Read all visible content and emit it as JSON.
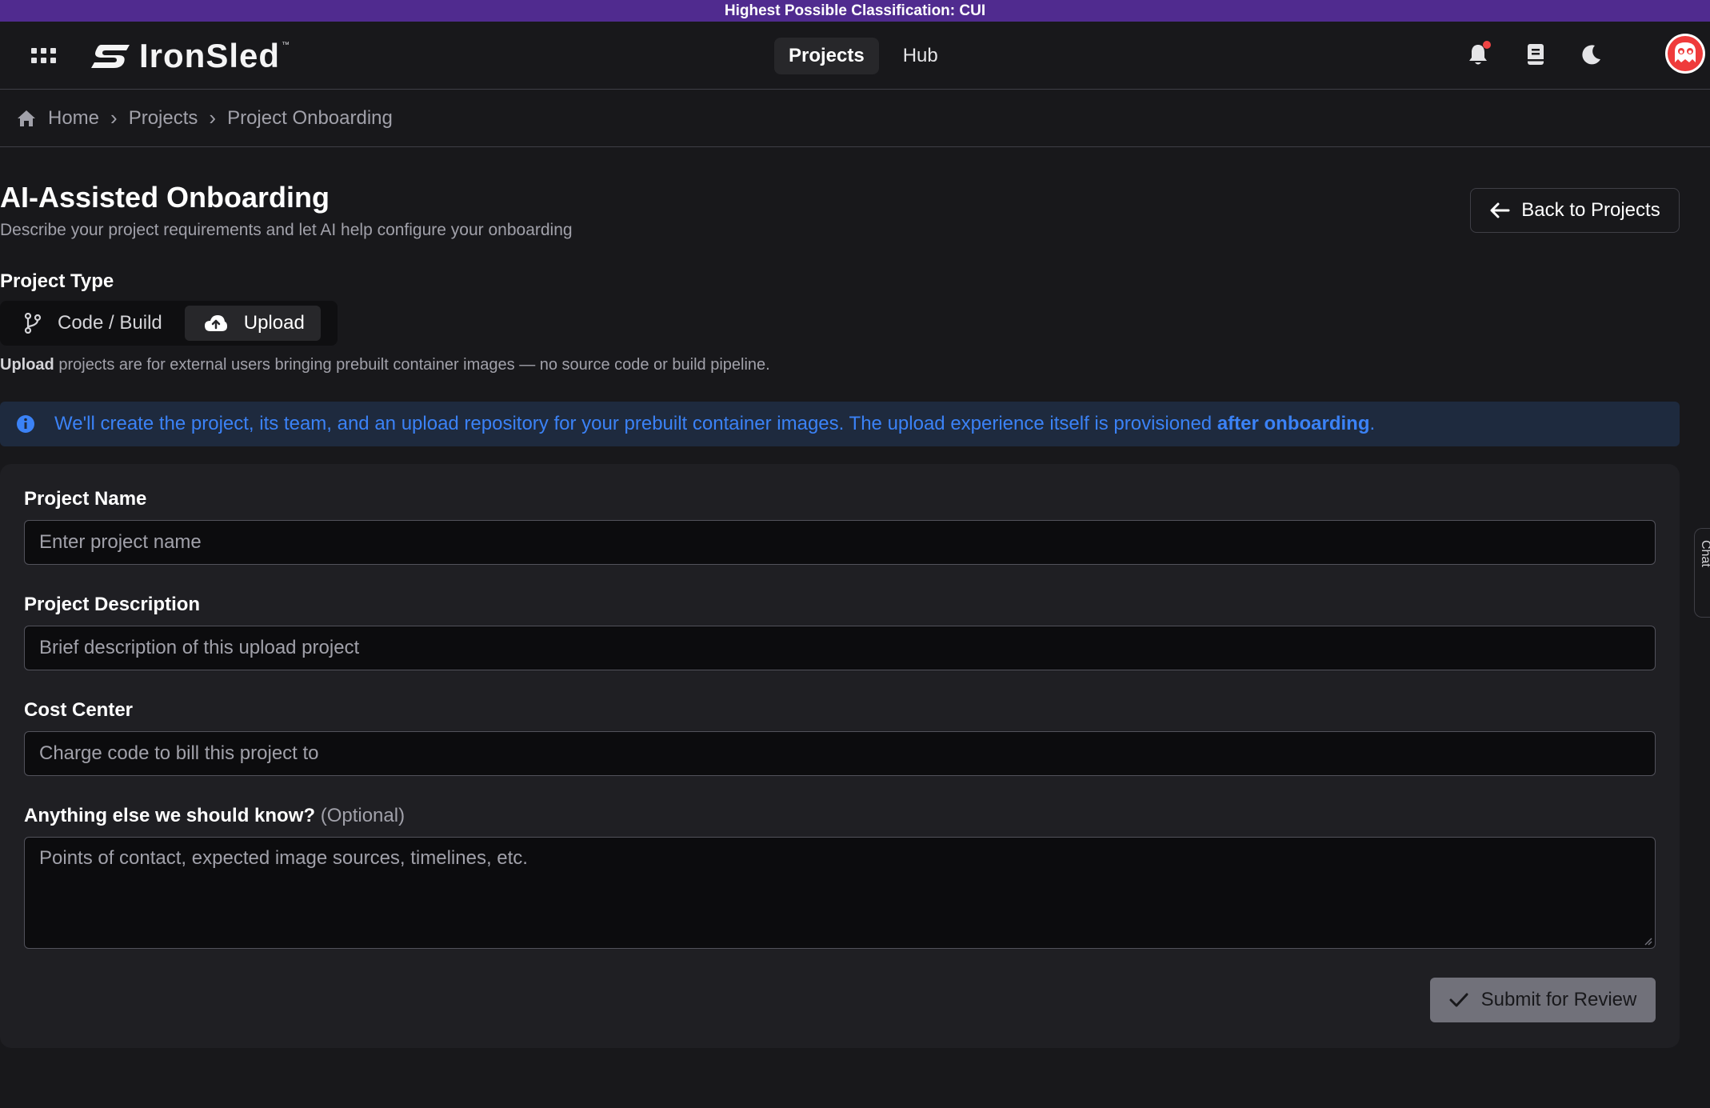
{
  "classification_banner": "Highest Possible Classification: CUI",
  "navbar": {
    "brand": "IronSled",
    "brand_tm": "™",
    "tabs": [
      {
        "label": "Projects",
        "active": true
      },
      {
        "label": "Hub",
        "active": false
      }
    ],
    "icons": [
      "apps-grid-icon",
      "bell-icon",
      "book-icon",
      "moon-icon",
      "avatar"
    ],
    "notification_dot_color": "#ef4444"
  },
  "breadcrumb": {
    "items": [
      "Home",
      "Projects",
      "Project Onboarding"
    ]
  },
  "header": {
    "title": "AI-Assisted Onboarding",
    "subtitle": "Describe your project requirements and let AI help configure your onboarding",
    "back_label": "Back to Projects"
  },
  "project_type": {
    "label": "Project Type",
    "options": [
      {
        "label": "Code / Build",
        "icon": "git-branch-icon",
        "active": false
      },
      {
        "label": "Upload",
        "icon": "cloud-upload-icon",
        "active": true
      }
    ],
    "note_bold": "Upload",
    "note_rest": " projects are for external users bringing prebuilt container images — no source code or build pipeline."
  },
  "info_banner": {
    "text": "We'll create the project, its team, and an upload repository for your prebuilt container images. The upload experience itself is provisioned ",
    "bold": "after onboarding",
    "end": "."
  },
  "form": {
    "project_name": {
      "label": "Project Name",
      "placeholder": "Enter project name"
    },
    "project_description": {
      "label": "Project Description",
      "placeholder": "Brief description of this upload project"
    },
    "cost_center": {
      "label": "Cost Center",
      "placeholder": "Charge code to bill this project to"
    },
    "anything_else": {
      "label": "Anything else we should know?",
      "optional": "(Optional)",
      "placeholder": "Points of contact, expected image sources, timelines, etc."
    },
    "submit_label": "Submit for Review"
  },
  "chat_tab": {
    "label": "Chat"
  },
  "colors": {
    "banner": "#502b8f",
    "accent_blue": "#3b82f6",
    "background": "#18181b",
    "card": "#1f1f23"
  }
}
